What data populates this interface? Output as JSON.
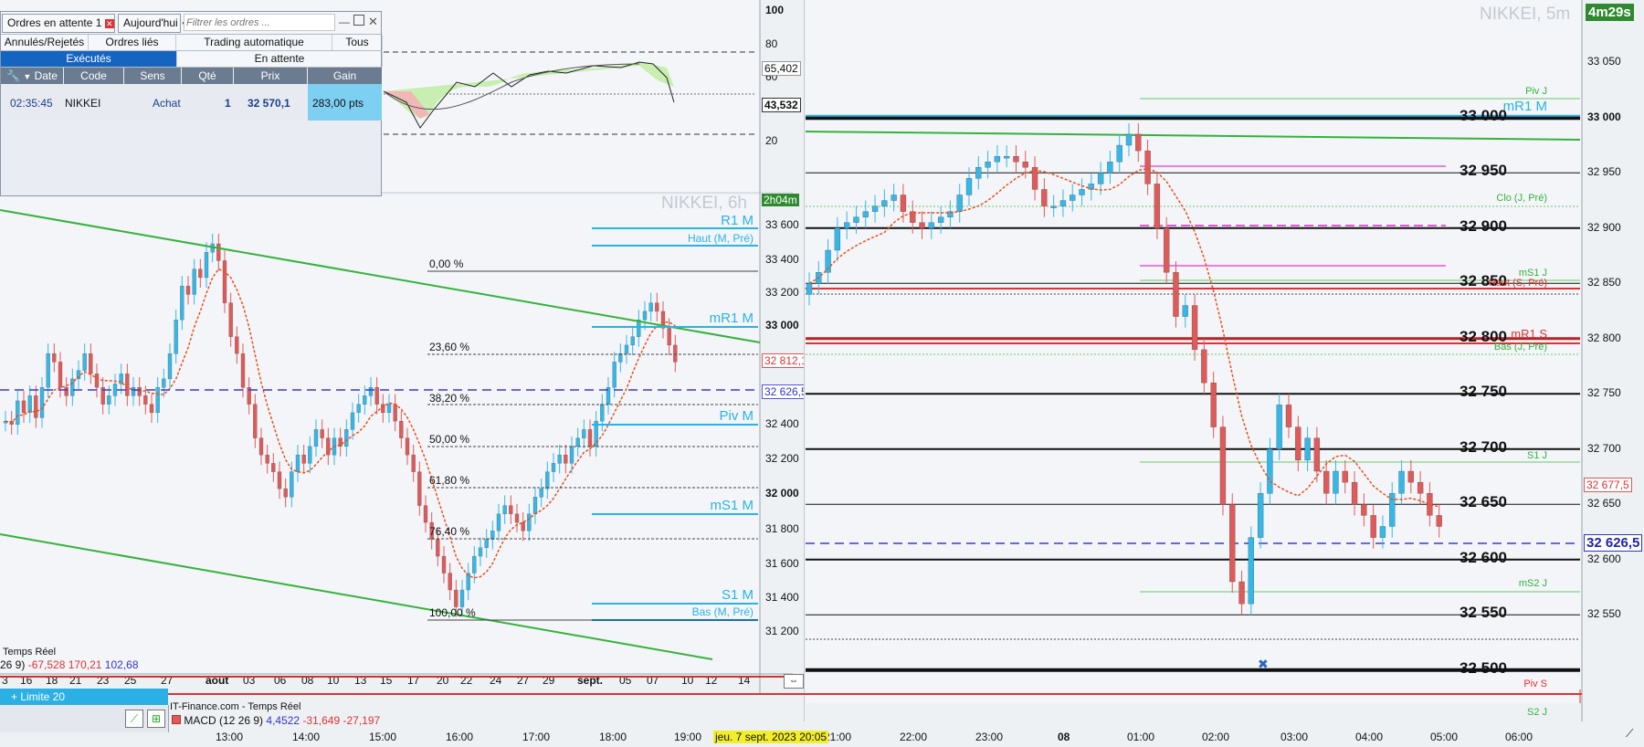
{
  "colors": {
    "up": "#35b8e8",
    "down": "#e05a5a",
    "channel": "#34b23c",
    "pivot_blue": "#29b3e6",
    "dashed_blue": "#3a3ad8",
    "pink": "#e65ad6",
    "ma": "#e8501e",
    "ma_green": "#7ccc2a"
  },
  "orders_panel": {
    "title": "Ordres en attente",
    "count": "1",
    "period": "Aujourd'hui",
    "filter_placeholder": "Filtrer les ordres ...",
    "tabs": [
      "Annulés/Rejetés",
      "Ordres liés",
      "Trading automatique",
      "Tous"
    ],
    "subtabs": [
      "Exécutés",
      "En attente"
    ],
    "columns": [
      "Date",
      "Code",
      "Sens",
      "Qté",
      "Prix",
      "Gain"
    ],
    "row": {
      "date": "02:35:45",
      "code": "NIKKEI",
      "sens": "Achat",
      "qty": "1",
      "price": "32 570,1",
      "gain": "283,00 pts"
    }
  },
  "oscillator": {
    "ticks": [
      "100",
      "80",
      "60",
      "20"
    ],
    "value_a": "65,402",
    "value_b": "43,532"
  },
  "left_chart": {
    "title": "NIKKEI, 6h",
    "timer": "2h04m",
    "ticks": [
      "33 600",
      "33 400",
      "33 200",
      "33 000",
      "32 400",
      "32 200",
      "32 000",
      "31 800",
      "31 600",
      "31 400",
      "31 200"
    ],
    "price_tag": "32 812,1",
    "price_tag2": "32 626,5",
    "fib": [
      "0,00 %",
      "23,60 %",
      "38,20 %",
      "50,00 %",
      "61,80 %",
      "76,40 %",
      "100,00 %"
    ],
    "pivot_labels": [
      "R1 M",
      "Haut (M, Pré)",
      "mR1 M",
      "Piv M",
      "mS1 M",
      "S1 M",
      "Bas (M, Pré)"
    ],
    "source": "Temps Réel",
    "macd": {
      "prefix": "26 9)",
      "v1": "-67,528",
      "v2": "170,21",
      "v3": "102,68"
    },
    "xaxis": [
      "3",
      "16",
      "18",
      "21",
      "23",
      "25",
      "27",
      "août",
      "03",
      "06",
      "08",
      "10",
      "13",
      "15",
      "17",
      "20",
      "22",
      "24",
      "27",
      "29",
      "sept.",
      "05",
      "07",
      "10",
      "12",
      "14"
    ]
  },
  "right_chart": {
    "title": "NIKKEI, 5m",
    "timer": "4m29s",
    "levels": [
      "33 000",
      "32 950",
      "32 900",
      "32 850",
      "32 800",
      "32 750",
      "32 700",
      "32 650",
      "32 600",
      "32 550",
      "32 500"
    ],
    "ticks": [
      "33 050",
      "33 000",
      "32 950",
      "32 900",
      "32 850",
      "32 800",
      "32 750",
      "32 700",
      "32 650",
      "32 600",
      "32 550"
    ],
    "pivot_labels": [
      "Piv J",
      "mR1 M",
      "Clo (J, Pré)",
      "mS1 J",
      "Haut (S, Pré)",
      "mR1 S",
      "Bas (J, Pré)",
      "S1 J",
      "mS2 J",
      "Piv S",
      "S2 J"
    ],
    "price_tag": "32 677,5",
    "last_price": "32 626,5",
    "xaxis": [
      "21:00",
      "22:00",
      "23:00",
      "08",
      "01:00",
      "02:00",
      "03:00",
      "04:00",
      "05:00",
      "06:00"
    ]
  },
  "bottom": {
    "order_label": "+ Limite 20",
    "source": "IT-Finance.com - Temps Réel",
    "macd": "MACD (12 26 9)",
    "macd_v1": "4,4522",
    "macd_v2": "-31,649",
    "macd_v3": "-27,197",
    "xaxis": [
      "13:00",
      "14:00",
      "15:00",
      "16:00",
      "17:00",
      "18:00",
      "19:00",
      "20:00"
    ],
    "timestamp": "jeu. 7 sept. 2023 20:05"
  }
}
